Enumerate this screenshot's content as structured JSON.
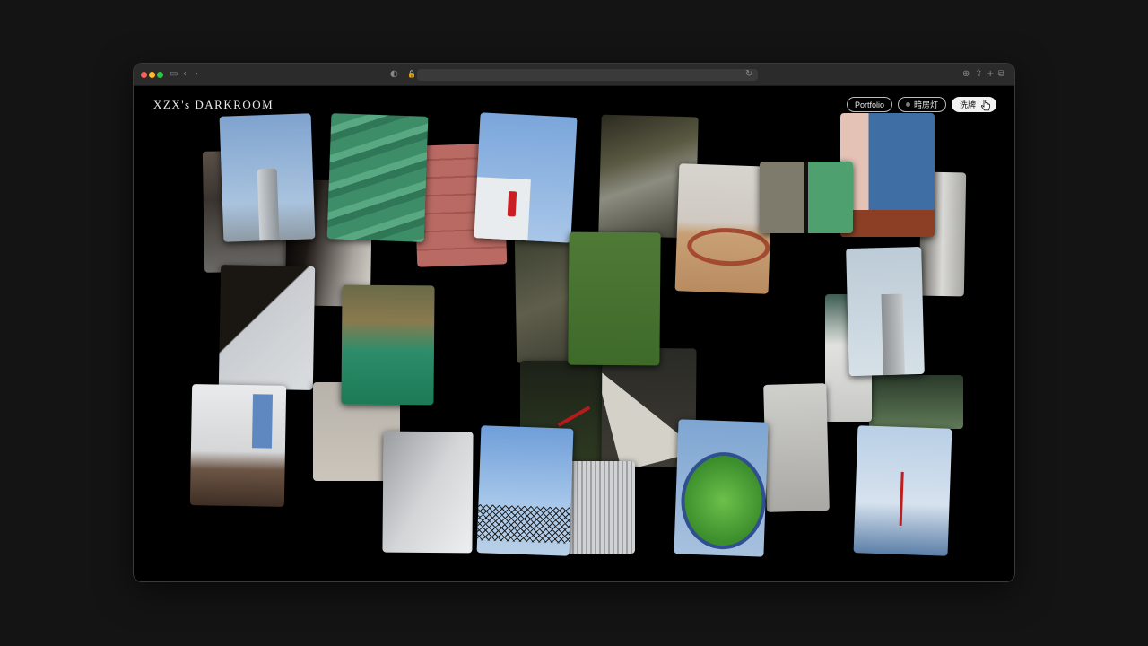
{
  "site": {
    "brand": "XZX's DARKROOM"
  },
  "nav": {
    "portfolio_label": "Portfolio",
    "darkroom_label": "暗房灯",
    "shuffle_label": "洗牌"
  },
  "browser": {
    "traffic_lights": [
      "#fe5f57",
      "#febc2e",
      "#28c840"
    ]
  },
  "photos": [
    {
      "name": "photo-concrete-corner"
    },
    {
      "name": "photo-tower-blue-sky"
    },
    {
      "name": "photo-dark-shadow"
    },
    {
      "name": "photo-green-tiles"
    },
    {
      "name": "photo-red-wall"
    },
    {
      "name": "photo-building-red-beacon"
    },
    {
      "name": "photo-diagonal-wall"
    },
    {
      "name": "photo-green-river"
    },
    {
      "name": "photo-rocky-stream"
    },
    {
      "name": "photo-grass-twigs"
    },
    {
      "name": "photo-playground-ring"
    },
    {
      "name": "photo-wall-green-tiles"
    },
    {
      "name": "photo-blue-panel-building"
    },
    {
      "name": "photo-window-frame"
    },
    {
      "name": "photo-grass-nail"
    },
    {
      "name": "photo-triangle-shadow"
    },
    {
      "name": "photo-red-object-grass"
    },
    {
      "name": "photo-office-tower"
    },
    {
      "name": "photo-white-steps"
    },
    {
      "name": "photo-trees-lawn"
    },
    {
      "name": "photo-classroom-chairs"
    },
    {
      "name": "photo-building-exterior"
    },
    {
      "name": "photo-white-stairs"
    },
    {
      "name": "photo-fence-sky"
    },
    {
      "name": "photo-metal-grille"
    },
    {
      "name": "photo-convex-mirror"
    },
    {
      "name": "photo-dry-vines"
    },
    {
      "name": "photo-round-building"
    }
  ]
}
